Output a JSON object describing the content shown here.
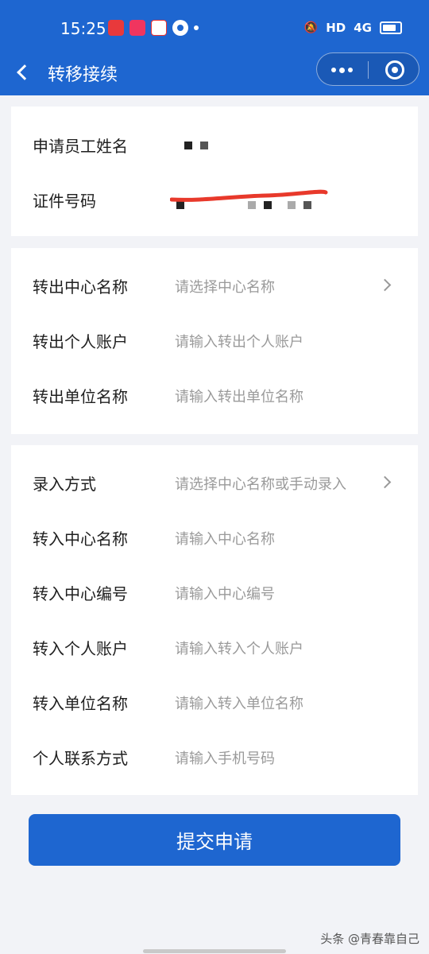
{
  "status_bar": {
    "time": "15:25",
    "network_hd": "HD",
    "network_4g": "4G"
  },
  "nav": {
    "title": "转移接续"
  },
  "applicant": {
    "name_label": "申请员工姓名",
    "id_label": "证件号码"
  },
  "transfer_out": {
    "rows": [
      {
        "label": "转出中心名称",
        "placeholder": "请选择中心名称",
        "has_chevron": true
      },
      {
        "label": "转出个人账户",
        "placeholder": "请输入转出个人账户"
      },
      {
        "label": "转出单位名称",
        "placeholder": "请输入转出单位名称"
      }
    ]
  },
  "transfer_in": {
    "rows": [
      {
        "label": "录入方式",
        "placeholder": "请选择中心名称或手动录入",
        "has_chevron": true
      },
      {
        "label": "转入中心名称",
        "placeholder": "请输入中心名称"
      },
      {
        "label": "转入中心编号",
        "placeholder": "请输入中心编号"
      },
      {
        "label": "转入个人账户",
        "placeholder": "请输入转入个人账户"
      },
      {
        "label": "转入单位名称",
        "placeholder": "请输入转入单位名称"
      },
      {
        "label": "个人联系方式",
        "placeholder": "请输入手机号码"
      }
    ]
  },
  "submit": {
    "label": "提交申请"
  },
  "watermark": "头条 @青春靠自己",
  "colors": {
    "primary": "#1e66d0",
    "background": "#f2f3f7",
    "placeholder": "#9a9a9a",
    "redaction": "#e8392b"
  }
}
